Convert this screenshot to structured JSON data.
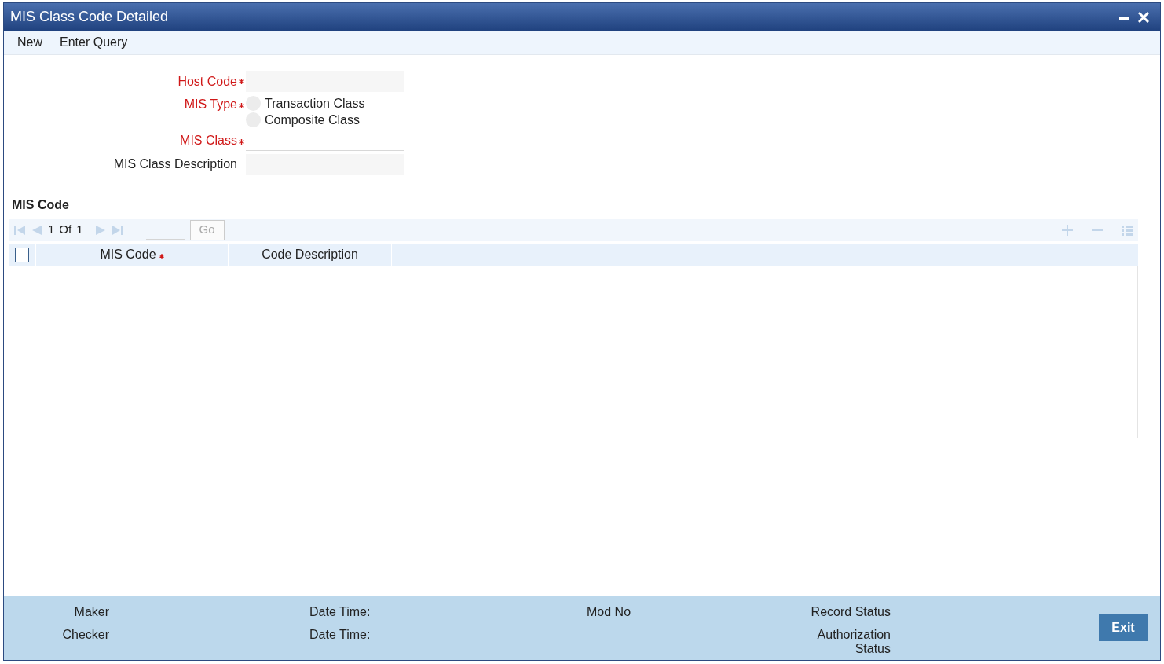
{
  "window": {
    "title": "MIS Class Code Detailed"
  },
  "toolbar": [
    {
      "label": "New"
    },
    {
      "label": "Enter Query"
    }
  ],
  "fields": [
    {
      "kind": "text",
      "label": "Host Code",
      "required": true
    },
    {
      "kind": "radio",
      "label": "MIS Type",
      "required": true,
      "options": [
        {
          "label": "Transaction Class",
          "selected": false
        },
        {
          "label": "Composite Class",
          "selected": false
        }
      ]
    },
    {
      "kind": "line",
      "label": "MIS Class",
      "required": true
    },
    {
      "kind": "text",
      "label": "MIS Class Description",
      "required": false
    }
  ],
  "grid": {
    "title": "MIS Code",
    "pager": {
      "current": "1",
      "of": "Of",
      "total": "1",
      "go": "Go"
    },
    "select_all": {
      "checked": false
    },
    "columns": [
      {
        "label": "MIS Code",
        "required": true
      },
      {
        "label": "Code Description",
        "required": false
      }
    ]
  },
  "footer": {
    "maker": "Maker",
    "checker": "Checker",
    "date_time_1": "Date Time:",
    "date_time_2": "Date Time:",
    "mod_no": "Mod No",
    "record_status": "Record Status",
    "authorization_status": "Authorization Status",
    "exit": "Exit"
  }
}
